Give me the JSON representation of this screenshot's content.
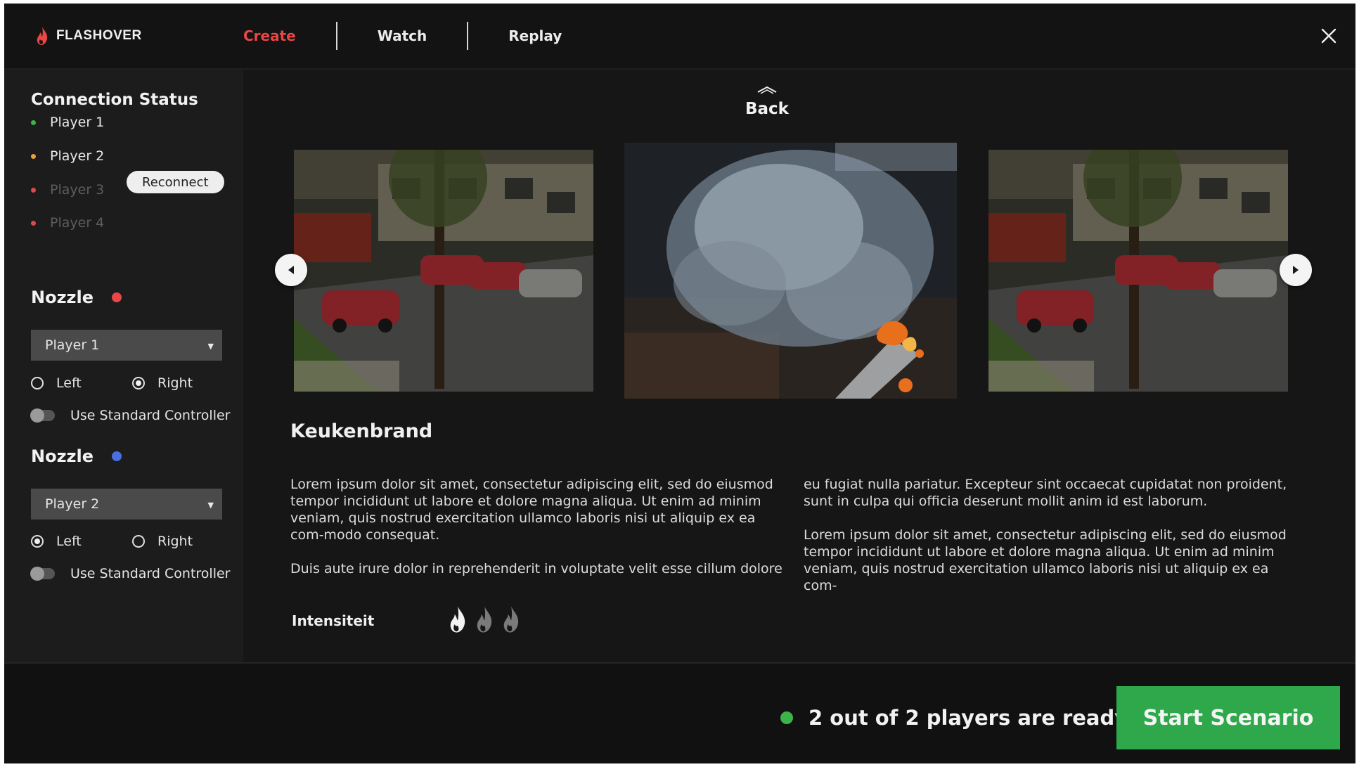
{
  "app": {
    "name": "FLASHOVER"
  },
  "nav": {
    "tabs": [
      {
        "label": "Create",
        "active": true
      },
      {
        "label": "Watch",
        "active": false
      },
      {
        "label": "Replay",
        "active": false
      }
    ]
  },
  "colors": {
    "accent": "#e94646",
    "ready": "#3cb449",
    "start_button": "#2ea84a",
    "status_ok": "#3cb449",
    "status_warn": "#e8a13a",
    "status_off": "#e04848",
    "nozzle_red": "#e94646",
    "nozzle_blue": "#4a6fe0"
  },
  "sidebar": {
    "connection_title": "Connection Status",
    "players": [
      {
        "label": "Player 1",
        "status": "connected",
        "color": "#3cb449"
      },
      {
        "label": "Player 2",
        "status": "warning",
        "color": "#e8a13a"
      },
      {
        "label": "Player 3",
        "status": "disconnected",
        "color": "#e04848"
      },
      {
        "label": "Player 4",
        "status": "disconnected",
        "color": "#e04848"
      }
    ],
    "reconnect_label": "Reconnect",
    "nozzles": [
      {
        "title": "Nozzle",
        "color": "#e94646",
        "selected_player": "Player 1",
        "left_label": "Left",
        "right_label": "Right",
        "side": "right",
        "standard_controller_label": "Use Standard Controller",
        "standard_controller": false
      },
      {
        "title": "Nozzle",
        "color": "#4a6fe0",
        "selected_player": "Player 2",
        "left_label": "Left",
        "right_label": "Right",
        "side": "left",
        "standard_controller_label": "Use Standard Controller",
        "standard_controller": false
      }
    ]
  },
  "main": {
    "back_label": "Back",
    "scenario_title": "Keukenbrand",
    "description_col1": [
      "Lorem ipsum dolor sit amet, consectetur adipiscing elit, sed do eiusmod tempor incididunt ut labore et dolore magna aliqua. Ut enim ad minim veniam, quis nostrud exercitation ullamco laboris nisi ut aliquip ex ea com-modo consequat.",
      "Duis aute irure dolor in reprehenderit in voluptate velit esse cillum dolore"
    ],
    "description_col2": [
      "eu fugiat nulla pariatur. Excepteur sint occaecat cupidatat non proident, sunt in culpa qui officia deserunt mollit anim id est laborum.",
      "Lorem ipsum dolor sit amet, consectetur adipiscing elit, sed do eiusmod tempor incididunt ut labore et dolore magna aliqua. Ut enim ad minim veniam, quis nostrud exercitation ullamco laboris nisi ut aliquip ex ea com-"
    ],
    "intensity_label": "Intensiteit",
    "intensity": {
      "value": 1,
      "max": 3
    }
  },
  "footer": {
    "ready_text": "2 out of 2 players are ready",
    "start_label": "Start Scenario"
  }
}
